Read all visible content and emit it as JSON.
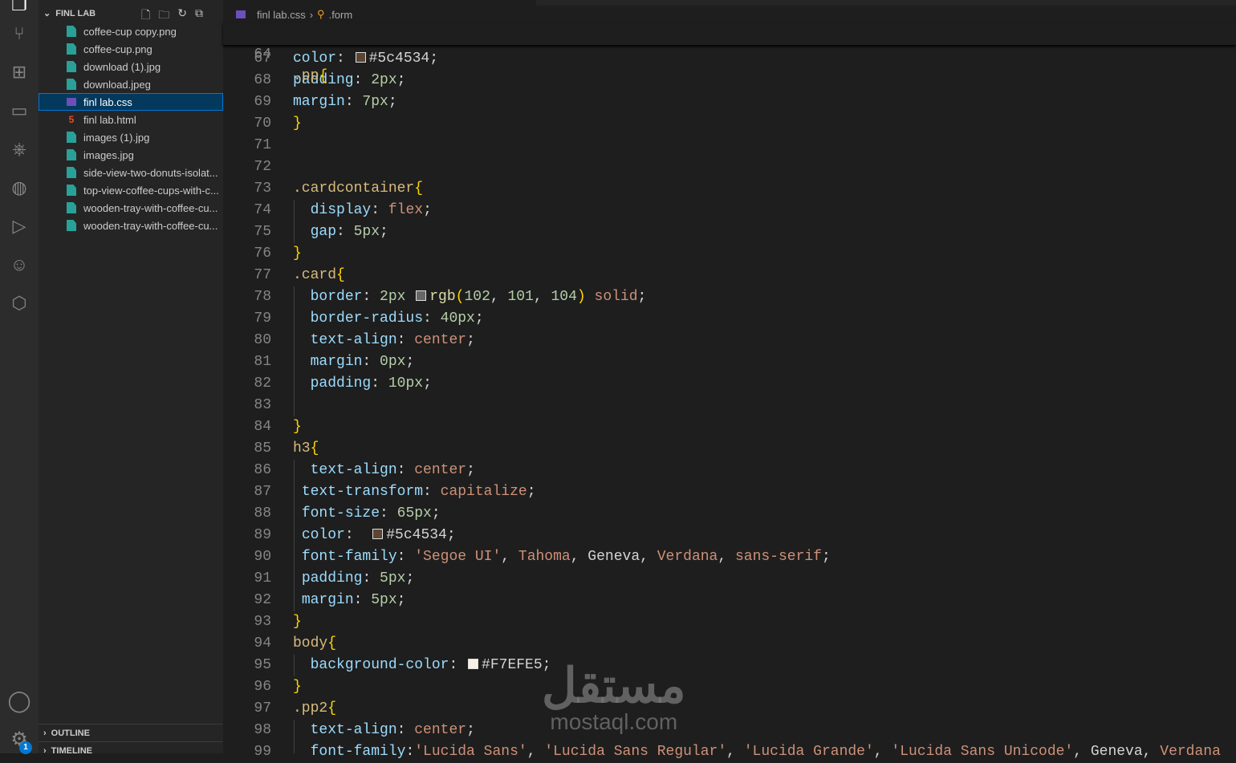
{
  "sidebar": {
    "title": "FINL LAB",
    "files": [
      {
        "name": "coffee-cup copy.png",
        "type": "image"
      },
      {
        "name": "coffee-cup.png",
        "type": "image"
      },
      {
        "name": "download (1).jpg",
        "type": "image"
      },
      {
        "name": "download.jpeg",
        "type": "image"
      },
      {
        "name": "finl lab.css",
        "type": "css",
        "selected": true
      },
      {
        "name": "finl lab.html",
        "type": "html"
      },
      {
        "name": "images (1).jpg",
        "type": "image"
      },
      {
        "name": "images.jpg",
        "type": "image"
      },
      {
        "name": "side-view-two-donuts-isolat...",
        "type": "image"
      },
      {
        "name": "top-view-coffee-cups-with-c...",
        "type": "image"
      },
      {
        "name": "wooden-tray-with-coffee-cu...",
        "type": "image"
      },
      {
        "name": "wooden-tray-with-coffee-cu...",
        "type": "image"
      }
    ],
    "outline": "OUTLINE",
    "timeline": "TIMELINE"
  },
  "activity": {
    "settings_badge": "1"
  },
  "breadcrumb": {
    "file": "finl lab.css",
    "symbol": ".form"
  },
  "sticky": {
    "num": "64",
    "tokens": [
      [
        "s",
        ".pp"
      ],
      [
        "b",
        "{"
      ]
    ]
  },
  "lines": [
    {
      "num": "67",
      "tokens": [
        [
          "p",
          "color"
        ],
        [
          "t",
          ": "
        ],
        [
          "sw",
          "#5c4534"
        ],
        [
          "t",
          "#5c4534;"
        ]
      ]
    },
    {
      "num": "68",
      "tokens": [
        [
          "p",
          "padding"
        ],
        [
          "t",
          ": "
        ],
        [
          "n",
          "2px"
        ],
        [
          "t",
          ";"
        ]
      ]
    },
    {
      "num": "69",
      "tokens": [
        [
          "p",
          "margin"
        ],
        [
          "t",
          ": "
        ],
        [
          "n",
          "7px"
        ],
        [
          "t",
          ";"
        ]
      ]
    },
    {
      "num": "70",
      "tokens": [
        [
          "b",
          "}"
        ]
      ]
    },
    {
      "num": "71",
      "tokens": []
    },
    {
      "num": "72",
      "tokens": []
    },
    {
      "num": "73",
      "tokens": [
        [
          "s",
          ".cardcontainer"
        ],
        [
          "b",
          "{"
        ]
      ]
    },
    {
      "num": "74",
      "tokens": [
        [
          "t",
          "  "
        ],
        [
          "p",
          "display"
        ],
        [
          "t",
          ": "
        ],
        [
          "v",
          "flex"
        ],
        [
          "t",
          ";"
        ]
      ]
    },
    {
      "num": "75",
      "tokens": [
        [
          "t",
          "  "
        ],
        [
          "p",
          "gap"
        ],
        [
          "t",
          ": "
        ],
        [
          "n",
          "5px"
        ],
        [
          "t",
          ";"
        ]
      ]
    },
    {
      "num": "76",
      "tokens": [
        [
          "b",
          "}"
        ]
      ]
    },
    {
      "num": "77",
      "tokens": [
        [
          "s",
          ".card"
        ],
        [
          "b",
          "{"
        ]
      ]
    },
    {
      "num": "78",
      "tokens": [
        [
          "t",
          "  "
        ],
        [
          "p",
          "border"
        ],
        [
          "t",
          ": "
        ],
        [
          "n",
          "2px "
        ],
        [
          "sw",
          "#666568"
        ],
        [
          "f",
          "rgb"
        ],
        [
          "b",
          "("
        ],
        [
          "n",
          "102"
        ],
        [
          "t",
          ", "
        ],
        [
          "n",
          "101"
        ],
        [
          "t",
          ", "
        ],
        [
          "n",
          "104"
        ],
        [
          "b",
          ")"
        ],
        [
          "v",
          " solid"
        ],
        [
          "t",
          ";"
        ]
      ]
    },
    {
      "num": "79",
      "tokens": [
        [
          "t",
          "  "
        ],
        [
          "p",
          "border-radius"
        ],
        [
          "t",
          ": "
        ],
        [
          "n",
          "40px"
        ],
        [
          "t",
          ";"
        ]
      ]
    },
    {
      "num": "80",
      "tokens": [
        [
          "t",
          "  "
        ],
        [
          "p",
          "text-align"
        ],
        [
          "t",
          ": "
        ],
        [
          "v",
          "center"
        ],
        [
          "t",
          ";"
        ]
      ]
    },
    {
      "num": "81",
      "tokens": [
        [
          "t",
          "  "
        ],
        [
          "p",
          "margin"
        ],
        [
          "t",
          ": "
        ],
        [
          "n",
          "0px"
        ],
        [
          "t",
          ";"
        ]
      ]
    },
    {
      "num": "82",
      "tokens": [
        [
          "t",
          "  "
        ],
        [
          "p",
          "padding"
        ],
        [
          "t",
          ": "
        ],
        [
          "n",
          "10px"
        ],
        [
          "t",
          ";"
        ]
      ]
    },
    {
      "num": "83",
      "tokens": []
    },
    {
      "num": "84",
      "tokens": [
        [
          "b",
          "}"
        ]
      ]
    },
    {
      "num": "85",
      "tokens": [
        [
          "s",
          "h3"
        ],
        [
          "b",
          "{"
        ]
      ]
    },
    {
      "num": "86",
      "tokens": [
        [
          "t",
          "  "
        ],
        [
          "p",
          "text-align"
        ],
        [
          "t",
          ": "
        ],
        [
          "v",
          "center"
        ],
        [
          "t",
          ";"
        ]
      ]
    },
    {
      "num": "87",
      "tokens": [
        [
          "t",
          " "
        ],
        [
          "p",
          "text-transform"
        ],
        [
          "t",
          ": "
        ],
        [
          "v",
          "capitalize"
        ],
        [
          "t",
          ";"
        ]
      ]
    },
    {
      "num": "88",
      "tokens": [
        [
          "t",
          " "
        ],
        [
          "p",
          "font-size"
        ],
        [
          "t",
          ": "
        ],
        [
          "n",
          "65px"
        ],
        [
          "t",
          ";"
        ]
      ]
    },
    {
      "num": "89",
      "tokens": [
        [
          "t",
          " "
        ],
        [
          "p",
          "color"
        ],
        [
          "t",
          ":  "
        ],
        [
          "sw",
          "#5c4534"
        ],
        [
          "t",
          "#5c4534;"
        ]
      ]
    },
    {
      "num": "90",
      "tokens": [
        [
          "t",
          " "
        ],
        [
          "p",
          "font-family"
        ],
        [
          "t",
          ": "
        ],
        [
          "v",
          "'Segoe UI'"
        ],
        [
          "t",
          ", "
        ],
        [
          "v",
          "Tahoma"
        ],
        [
          "t",
          ", Geneva, "
        ],
        [
          "v",
          "Verdana"
        ],
        [
          "t",
          ", "
        ],
        [
          "v",
          "sans-serif"
        ],
        [
          "t",
          ";"
        ]
      ]
    },
    {
      "num": "91",
      "tokens": [
        [
          "t",
          " "
        ],
        [
          "p",
          "padding"
        ],
        [
          "t",
          ": "
        ],
        [
          "n",
          "5px"
        ],
        [
          "t",
          ";"
        ]
      ]
    },
    {
      "num": "92",
      "tokens": [
        [
          "t",
          " "
        ],
        [
          "p",
          "margin"
        ],
        [
          "t",
          ": "
        ],
        [
          "n",
          "5px"
        ],
        [
          "t",
          ";"
        ]
      ]
    },
    {
      "num": "93",
      "tokens": [
        [
          "b",
          "}"
        ]
      ]
    },
    {
      "num": "94",
      "tokens": [
        [
          "s",
          "body"
        ],
        [
          "b",
          "{"
        ]
      ]
    },
    {
      "num": "95",
      "tokens": [
        [
          "t",
          "  "
        ],
        [
          "p",
          "background-color"
        ],
        [
          "t",
          ": "
        ],
        [
          "sw",
          "#F7EFE5"
        ],
        [
          "t",
          "#F7EFE5;"
        ]
      ]
    },
    {
      "num": "96",
      "tokens": [
        [
          "b",
          "}"
        ]
      ]
    },
    {
      "num": "97",
      "tokens": [
        [
          "s",
          ".pp2"
        ],
        [
          "b",
          "{"
        ]
      ]
    },
    {
      "num": "98",
      "tokens": [
        [
          "t",
          "  "
        ],
        [
          "p",
          "text-align"
        ],
        [
          "t",
          ": "
        ],
        [
          "v",
          "center"
        ],
        [
          "t",
          ";"
        ]
      ]
    },
    {
      "num": "99",
      "tokens": [
        [
          "t",
          "  "
        ],
        [
          "p",
          "font-family"
        ],
        [
          "t",
          ":"
        ],
        [
          "v",
          "'Lucida Sans'"
        ],
        [
          "t",
          ", "
        ],
        [
          "v",
          "'Lucida Sans Regular'"
        ],
        [
          "t",
          ", "
        ],
        [
          "v",
          "'Lucida Grande'"
        ],
        [
          "t",
          ", "
        ],
        [
          "v",
          "'Lucida Sans Unicode'"
        ],
        [
          "t",
          ", Geneva, "
        ],
        [
          "v",
          "Verdana"
        ]
      ]
    }
  ],
  "watermark": {
    "arabic": "مستقل",
    "latin": "mostaql.com"
  }
}
